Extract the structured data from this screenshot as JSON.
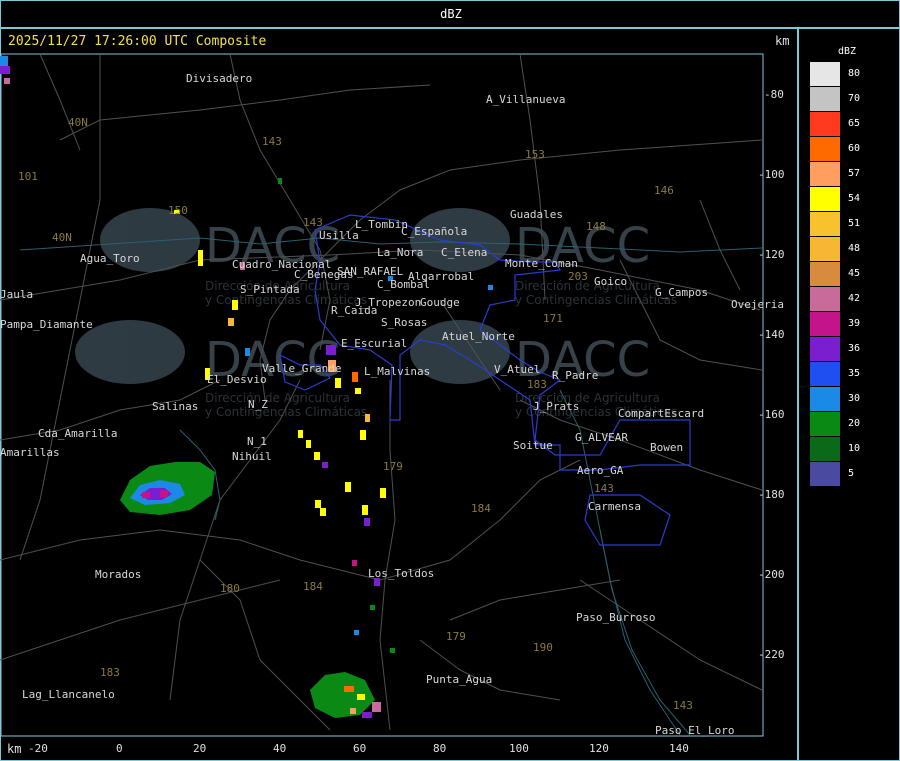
{
  "header": {
    "title": "dBZ"
  },
  "map": {
    "timestamp": "2025/11/27 17:26:00 UTC Composite",
    "axis_unit": "km",
    "x_ticks": [
      "-20",
      "0",
      "20",
      "40",
      "60",
      "80",
      "100",
      "120",
      "140"
    ],
    "y_ticks": [
      "-80",
      "-100",
      "-120",
      "-140",
      "-160",
      "-180",
      "-200",
      "-220"
    ],
    "places": [
      "Divisadero",
      "A_Villanueva",
      "Guadales",
      "L_Tombin",
      "C_Española",
      "C_Elena",
      "Agua_Toro",
      "Usilla",
      "La_Nora",
      "C_Benegas",
      "SAN_RAFAEL",
      "Algarrobal",
      "C_Bombal",
      "R_Caida",
      "S_Pintada",
      "J_Tropezon",
      "Goudge",
      "Cuadro_Nacional",
      "S_Rosas",
      "Atuel_Norte",
      "Pampa_Diamante",
      "E_Escurial",
      "Valle_Grande",
      "L_Malvinas",
      "El_Desvio",
      "V_Atuel",
      "R_Padre",
      "Salinas",
      "N_Z",
      "N_1",
      "Nihuil",
      "Cda_Amarilla",
      "J_Prats",
      "CompartEscard",
      "G_ALVEAR",
      "Bowen",
      "Soitue",
      "Aero_GA",
      "Carmensa",
      "Morados",
      "Los_Toldos",
      "Paso_Burroso",
      "Punta_Agua",
      "Lag_Llancanelo",
      "Paso_El_Loro",
      "Goico",
      "G_Campos",
      "Ovejeria",
      "Monte_Coman",
      "Jaula",
      "Amarillas"
    ],
    "routes": [
      "40N",
      "40N",
      "101",
      "143",
      "153",
      "146",
      "148",
      "203",
      "171",
      "143",
      "183",
      "179",
      "184",
      "180",
      "184",
      "183",
      "179",
      "190",
      "143",
      "143",
      "150"
    ],
    "watermark": {
      "brand": "DACC",
      "line1": "Dirección de Agricultura",
      "line2": "y Contingencias Climáticas"
    }
  },
  "legend": {
    "title": "dBZ",
    "levels": [
      {
        "label": "80",
        "color": "#e6e6e6"
      },
      {
        "label": "70",
        "color": "#c4c4c4"
      },
      {
        "label": "65",
        "color": "#ff3a1e"
      },
      {
        "label": "60",
        "color": "#ff6a00"
      },
      {
        "label": "57",
        "color": "#ff9e5e"
      },
      {
        "label": "54",
        "color": "#ffff00"
      },
      {
        "label": "51",
        "color": "#f7c22e"
      },
      {
        "label": "48",
        "color": "#f7b733"
      },
      {
        "label": "45",
        "color": "#d88a3e"
      },
      {
        "label": "42",
        "color": "#c86a9a"
      },
      {
        "label": "39",
        "color": "#c4148c"
      },
      {
        "label": "36",
        "color": "#7a1ed0"
      },
      {
        "label": "35",
        "color": "#1f4ff0"
      },
      {
        "label": "30",
        "color": "#1a8ae6"
      },
      {
        "label": "20",
        "color": "#0a8a14"
      },
      {
        "label": "10",
        "color": "#0a6a18"
      },
      {
        "label": "5",
        "color": "#4a4aa0"
      }
    ]
  }
}
